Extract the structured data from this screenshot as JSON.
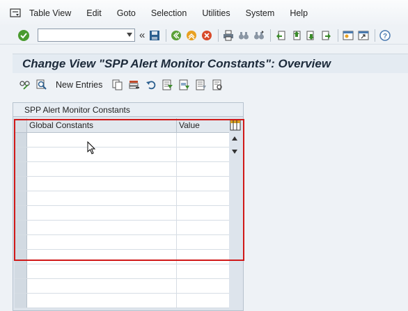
{
  "menu": {
    "items": [
      {
        "label": "Table View"
      },
      {
        "label": "Edit"
      },
      {
        "label": "Goto"
      },
      {
        "label": "Selection"
      },
      {
        "label": "Utilities"
      },
      {
        "label": "System"
      },
      {
        "label": "Help"
      }
    ]
  },
  "toolbar": {
    "command_field_value": ""
  },
  "page": {
    "title": "Change View \"SPP Alert Monitor Constants\": Overview"
  },
  "app_toolbar": {
    "new_entries_label": "New Entries"
  },
  "table": {
    "title": "SPP Alert Monitor Constants",
    "columns": [
      "Global Constants",
      "Value"
    ],
    "rows": [
      [
        "",
        ""
      ],
      [
        "",
        ""
      ],
      [
        "",
        ""
      ],
      [
        "",
        ""
      ],
      [
        "",
        ""
      ],
      [
        "",
        ""
      ],
      [
        "",
        ""
      ],
      [
        "",
        ""
      ],
      [
        "",
        ""
      ],
      [
        "",
        ""
      ],
      [
        "",
        ""
      ],
      [
        "",
        ""
      ]
    ]
  },
  "colors": {
    "highlight_border": "#d01818",
    "title_text": "#1c2a3a"
  }
}
